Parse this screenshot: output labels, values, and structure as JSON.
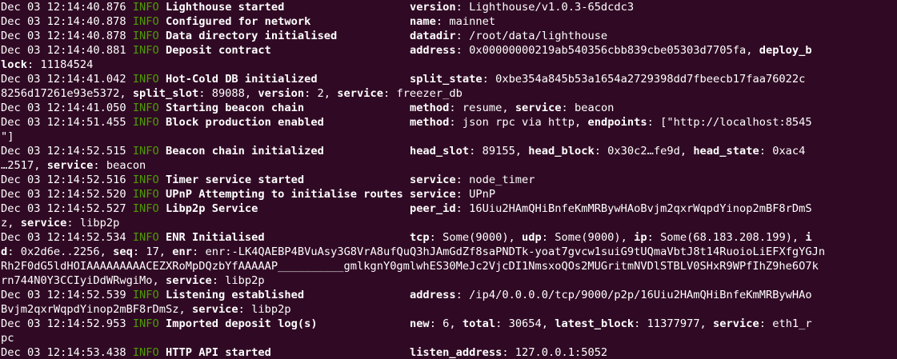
{
  "terminal": {
    "background": "#300a24",
    "text_color": "#ffffff",
    "info_color": "#4e9a06",
    "lines": [
      [
        {
          "t": "Dec 03 12:14:40.876 "
        },
        {
          "t": "INFO",
          "c": "lvl"
        },
        {
          "t": " "
        },
        {
          "t": "Lighthouse started",
          "c": "b"
        },
        {
          "t": "                   "
        },
        {
          "t": "version",
          "c": "b"
        },
        {
          "t": ": Lighthouse/v1.0.3-65dcdc3"
        }
      ],
      [
        {
          "t": "Dec 03 12:14:40.878 "
        },
        {
          "t": "INFO",
          "c": "lvl"
        },
        {
          "t": " "
        },
        {
          "t": "Configured for network",
          "c": "b"
        },
        {
          "t": "               "
        },
        {
          "t": "name",
          "c": "b"
        },
        {
          "t": ": mainnet"
        }
      ],
      [
        {
          "t": "Dec 03 12:14:40.878 "
        },
        {
          "t": "INFO",
          "c": "lvl"
        },
        {
          "t": " "
        },
        {
          "t": "Data directory initialised",
          "c": "b"
        },
        {
          "t": "           "
        },
        {
          "t": "datadir",
          "c": "b"
        },
        {
          "t": ": /root/data/lighthouse"
        }
      ],
      [
        {
          "t": "Dec 03 12:14:40.881 "
        },
        {
          "t": "INFO",
          "c": "lvl"
        },
        {
          "t": " "
        },
        {
          "t": "Deposit contract",
          "c": "b"
        },
        {
          "t": "                     "
        },
        {
          "t": "address",
          "c": "b"
        },
        {
          "t": ": 0x00000000219ab540356cbb839cbe05303d7705fa, "
        },
        {
          "t": "deploy_b",
          "c": "b"
        }
      ],
      [
        {
          "t": "lock",
          "c": "b"
        },
        {
          "t": ": 11184524"
        }
      ],
      [
        {
          "t": "Dec 03 12:14:41.042 "
        },
        {
          "t": "INFO",
          "c": "lvl"
        },
        {
          "t": " "
        },
        {
          "t": "Hot-Cold DB initialized",
          "c": "b"
        },
        {
          "t": "              "
        },
        {
          "t": "split_state",
          "c": "b"
        },
        {
          "t": ": 0xbe354a845b53a1654a2729398dd7fbeecb17faa76022c"
        }
      ],
      [
        {
          "t": "8256d17261e93e5372, "
        },
        {
          "t": "split_slot",
          "c": "b"
        },
        {
          "t": ": 89088, "
        },
        {
          "t": "version",
          "c": "b"
        },
        {
          "t": ": 2, "
        },
        {
          "t": "service",
          "c": "b"
        },
        {
          "t": ": freezer_db"
        }
      ],
      [
        {
          "t": "Dec 03 12:14:41.050 "
        },
        {
          "t": "INFO",
          "c": "lvl"
        },
        {
          "t": " "
        },
        {
          "t": "Starting beacon chain",
          "c": "b"
        },
        {
          "t": "                "
        },
        {
          "t": "method",
          "c": "b"
        },
        {
          "t": ": resume, "
        },
        {
          "t": "service",
          "c": "b"
        },
        {
          "t": ": beacon"
        }
      ],
      [
        {
          "t": "Dec 03 12:14:51.455 "
        },
        {
          "t": "INFO",
          "c": "lvl"
        },
        {
          "t": " "
        },
        {
          "t": "Block production enabled",
          "c": "b"
        },
        {
          "t": "             "
        },
        {
          "t": "method",
          "c": "b"
        },
        {
          "t": ": json rpc via http, "
        },
        {
          "t": "endpoints",
          "c": "b"
        },
        {
          "t": ": [\"http://localhost:8545"
        }
      ],
      [
        {
          "t": "\"]"
        }
      ],
      [
        {
          "t": "Dec 03 12:14:52.515 "
        },
        {
          "t": "INFO",
          "c": "lvl"
        },
        {
          "t": " "
        },
        {
          "t": "Beacon chain initialized",
          "c": "b"
        },
        {
          "t": "             "
        },
        {
          "t": "head_slot",
          "c": "b"
        },
        {
          "t": ": 89155, "
        },
        {
          "t": "head_block",
          "c": "b"
        },
        {
          "t": ": 0x30c2…fe9d, "
        },
        {
          "t": "head_state",
          "c": "b"
        },
        {
          "t": ": 0xac4"
        }
      ],
      [
        {
          "t": "…2517, "
        },
        {
          "t": "service",
          "c": "b"
        },
        {
          "t": ": beacon"
        }
      ],
      [
        {
          "t": "Dec 03 12:14:52.516 "
        },
        {
          "t": "INFO",
          "c": "lvl"
        },
        {
          "t": " "
        },
        {
          "t": "Timer service started",
          "c": "b"
        },
        {
          "t": "                "
        },
        {
          "t": "service",
          "c": "b"
        },
        {
          "t": ": node_timer"
        }
      ],
      [
        {
          "t": "Dec 03 12:14:52.520 "
        },
        {
          "t": "INFO",
          "c": "lvl"
        },
        {
          "t": " "
        },
        {
          "t": "UPnP Attempting to initialise routes",
          "c": "b"
        },
        {
          "t": " "
        },
        {
          "t": "service",
          "c": "b"
        },
        {
          "t": ": UPnP"
        }
      ],
      [
        {
          "t": "Dec 03 12:14:52.527 "
        },
        {
          "t": "INFO",
          "c": "lvl"
        },
        {
          "t": " "
        },
        {
          "t": "Libp2p Service",
          "c": "b"
        },
        {
          "t": "                       "
        },
        {
          "t": "peer_id",
          "c": "b"
        },
        {
          "t": ": 16Uiu2HAmQHiBnfeKmMRBywHAoBvjm2qxrWqpdYinop2mBF8rDmS"
        }
      ],
      [
        {
          "t": "z, "
        },
        {
          "t": "service",
          "c": "b"
        },
        {
          "t": ": libp2p"
        }
      ],
      [
        {
          "t": "Dec 03 12:14:52.534 "
        },
        {
          "t": "INFO",
          "c": "lvl"
        },
        {
          "t": " "
        },
        {
          "t": "ENR Initialised",
          "c": "b"
        },
        {
          "t": "                      "
        },
        {
          "t": "tcp",
          "c": "b"
        },
        {
          "t": ": Some(9000), "
        },
        {
          "t": "udp",
          "c": "b"
        },
        {
          "t": ": Some(9000), "
        },
        {
          "t": "ip",
          "c": "b"
        },
        {
          "t": ": Some(68.183.208.199), "
        },
        {
          "t": "i",
          "c": "b"
        }
      ],
      [
        {
          "t": "d",
          "c": "b"
        },
        {
          "t": ": 0x2d6e..2256, "
        },
        {
          "t": "seq",
          "c": "b"
        },
        {
          "t": ": 17, "
        },
        {
          "t": "enr",
          "c": "b"
        },
        {
          "t": ": enr:-LK4QAEBP4BVuAsy3G8VrA8ufQuQ3hJAmGdZf8saPNDTk-yoat7gvcw1suiG9tUQmaVbtJ8t14RuoioLiEFXfgYGJn"
        }
      ],
      [
        {
          "t": "Rh2F0dG5ldHOIAAAAAAAAACEZXRoMpDQzbYfAAAAAP__________gmlkgnY0gmlwhES30MeJc2VjcDI1NmsxoQOs2MUGritmNVDlSTBLV0SHxR9WPfIhZ9he6O7k"
        }
      ],
      [
        {
          "t": "rn744N0Y3CCIyiDdWRwgiMo, "
        },
        {
          "t": "service",
          "c": "b"
        },
        {
          "t": ": libp2p"
        }
      ],
      [
        {
          "t": "Dec 03 12:14:52.539 "
        },
        {
          "t": "INFO",
          "c": "lvl"
        },
        {
          "t": " "
        },
        {
          "t": "Listening established",
          "c": "b"
        },
        {
          "t": "                "
        },
        {
          "t": "address",
          "c": "b"
        },
        {
          "t": ": /ip4/0.0.0.0/tcp/9000/p2p/16Uiu2HAmQHiBnfeKmMRBywHAo"
        }
      ],
      [
        {
          "t": "Bvjm2qxrWqpdYinop2mBF8rDmSz, "
        },
        {
          "t": "service",
          "c": "b"
        },
        {
          "t": ": libp2p"
        }
      ],
      [
        {
          "t": "Dec 03 12:14:52.953 "
        },
        {
          "t": "INFO",
          "c": "lvl"
        },
        {
          "t": " "
        },
        {
          "t": "Imported deposit log(s)",
          "c": "b"
        },
        {
          "t": "              "
        },
        {
          "t": "new",
          "c": "b"
        },
        {
          "t": ": 6, "
        },
        {
          "t": "total",
          "c": "b"
        },
        {
          "t": ": 30654, "
        },
        {
          "t": "latest_block",
          "c": "b"
        },
        {
          "t": ": 11377977, "
        },
        {
          "t": "service",
          "c": "b"
        },
        {
          "t": ": eth1_r"
        }
      ],
      [
        {
          "t": "pc"
        }
      ],
      [
        {
          "t": "Dec 03 12:14:53.438 "
        },
        {
          "t": "INFO",
          "c": "lvl"
        },
        {
          "t": " "
        },
        {
          "t": "HTTP API started",
          "c": "b"
        },
        {
          "t": "                     "
        },
        {
          "t": "listen_address",
          "c": "b"
        },
        {
          "t": ": 127.0.0.1:5052"
        }
      ]
    ]
  }
}
